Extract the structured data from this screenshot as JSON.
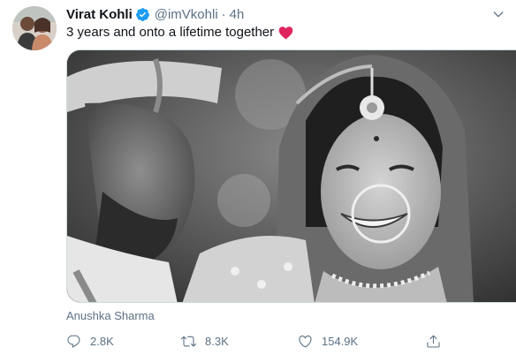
{
  "tweet": {
    "author_name": "Virat Kohli",
    "handle": "@imVkohli",
    "separator": "·",
    "time": "4h",
    "text": "3 years and onto a lifetime together",
    "tagged_user": "Anushka Sharma",
    "verified": true,
    "icons": {
      "avatar": "avatar",
      "verified": "verified-badge-icon",
      "more": "chevron-down-icon",
      "emoji": "red-heart-emoji"
    },
    "stats": {
      "replies": "2.8K",
      "retweets": "8.3K",
      "likes": "154.9K"
    }
  },
  "colors": {
    "verified_blue": "#1d9bf0",
    "secondary_text": "#5b7083",
    "primary_text": "#0f1419",
    "heart_red": "#e0245e"
  }
}
